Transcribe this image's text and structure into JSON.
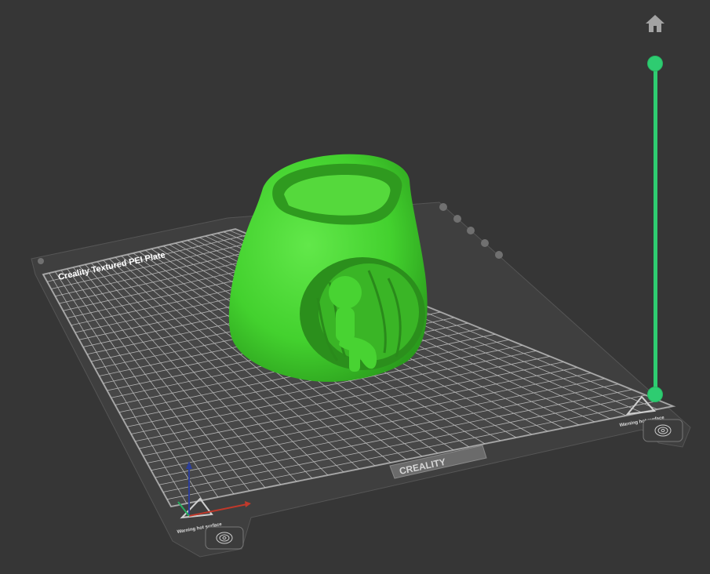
{
  "app": {
    "view": "3D Preparation view",
    "background": "#363636"
  },
  "bed": {
    "plate_label": "Creality Textured PEI Plate",
    "brand_logo": "CREALITY",
    "warning_label": "Warning hot surface",
    "colors": {
      "plate": "#4a4a4a",
      "grid": "#bfbfbf",
      "frame": "#5a5a5a"
    }
  },
  "model": {
    "color": "#43d12e",
    "icon": "figure-planter-model"
  },
  "axes": {
    "x_color": "#c0392b",
    "y_color": "#27ae60",
    "z_color": "#2c3e99"
  },
  "controls": {
    "home_icon": "home-icon",
    "layer_slider": {
      "accent": "#2ecc71",
      "top_value": 1.0,
      "bottom_value": 0.0
    }
  }
}
